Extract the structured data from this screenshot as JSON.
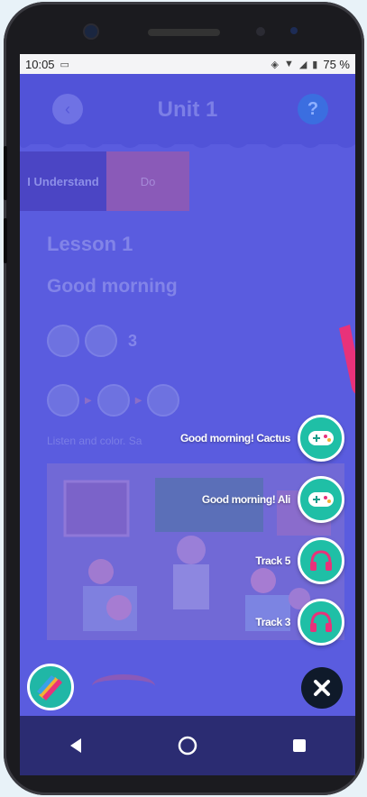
{
  "status_bar": {
    "time": "10:05",
    "battery": "75 %"
  },
  "header": {
    "title": "Unit 1",
    "help_symbol": "?"
  },
  "tabs": [
    {
      "label": "I Understand"
    },
    {
      "label": "Do"
    }
  ],
  "lesson": {
    "title": "Lesson 1",
    "subtitle": "Good morning",
    "count": "3",
    "instruction": "Listen and color. Sa"
  },
  "menu_items": [
    {
      "label": "Good morning! Cactus",
      "icon": "game-controller-icon"
    },
    {
      "label": "Good morning! Ali",
      "icon": "game-controller-icon"
    },
    {
      "label": "Track 5",
      "icon": "headphones-icon"
    },
    {
      "label": "Track 3",
      "icon": "headphones-icon"
    }
  ],
  "colors": {
    "overlay": "#5a5cdf",
    "fab_teal": "#1fbfa6",
    "close_dark": "#0f1a2a",
    "pink_accent": "#e8327a"
  }
}
